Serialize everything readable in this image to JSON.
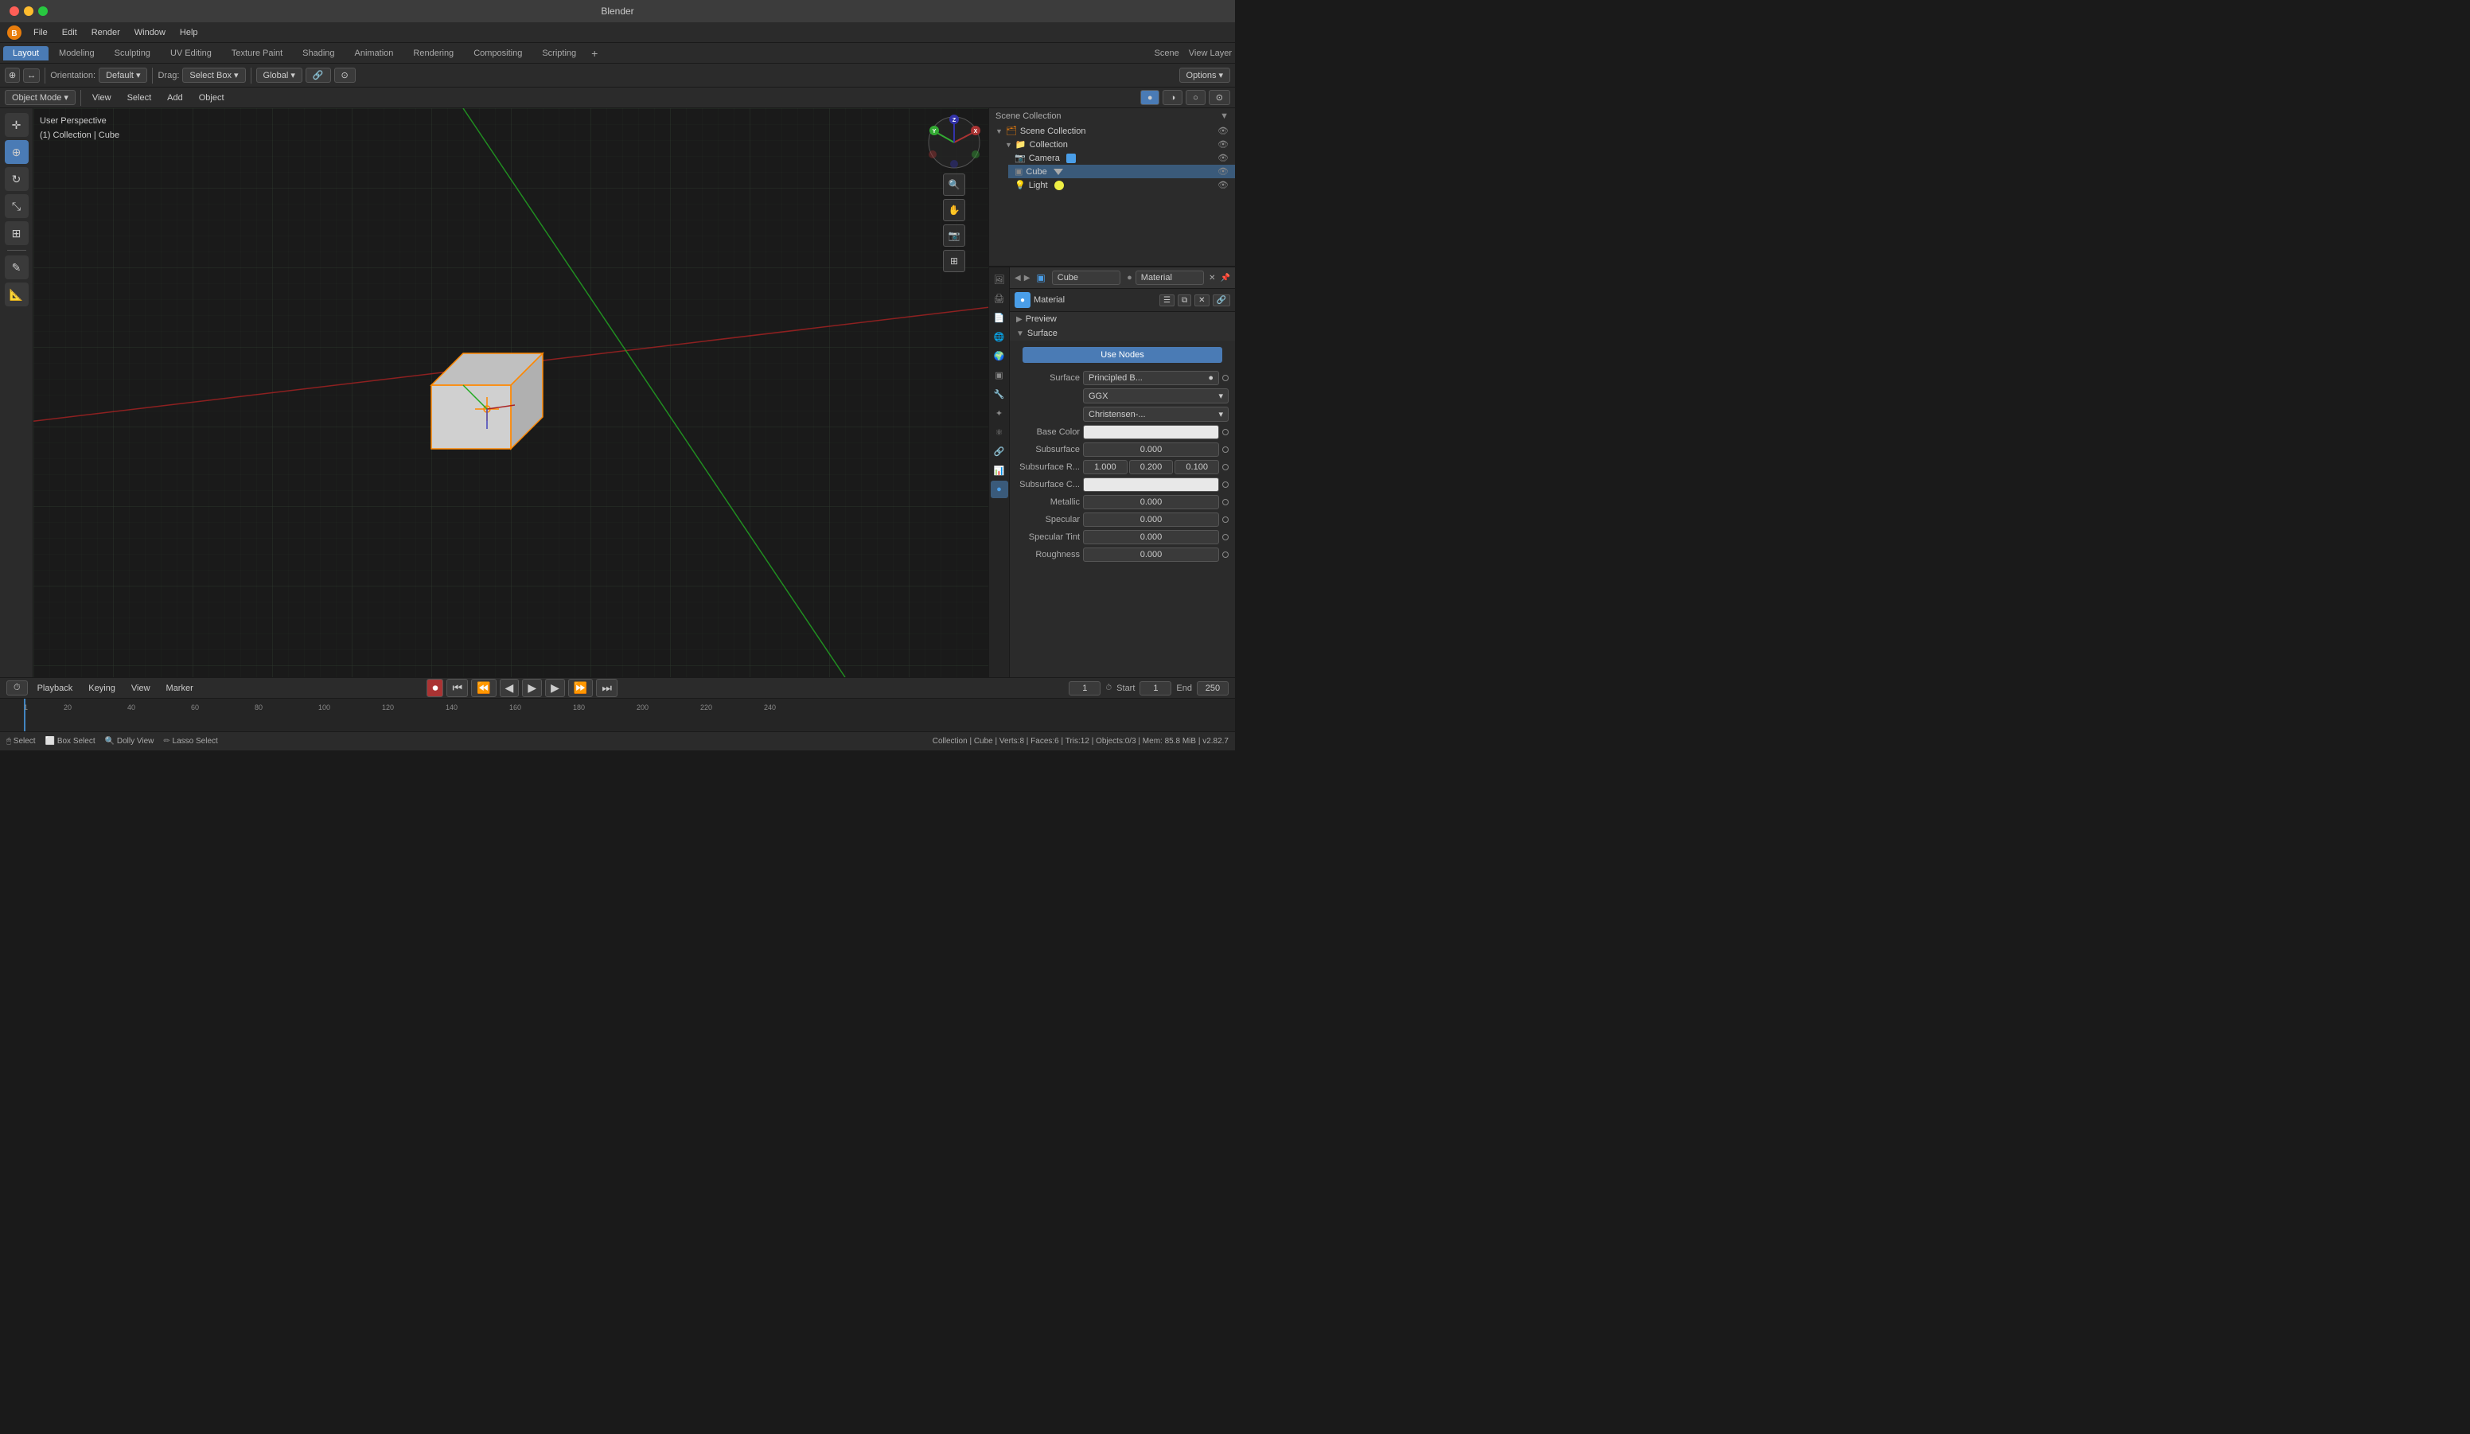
{
  "titleBar": {
    "title": "Blender"
  },
  "menuBar": {
    "items": [
      "File",
      "Edit",
      "Render",
      "Window",
      "Help"
    ]
  },
  "workspaceTabs": {
    "tabs": [
      "Layout",
      "Modeling",
      "Sculpting",
      "UV Editing",
      "Texture Paint",
      "Shading",
      "Animation",
      "Rendering",
      "Compositing",
      "Scripting"
    ],
    "activeTab": "Layout"
  },
  "topToolbar": {
    "orientation_label": "Orientation:",
    "orientation_value": "Default",
    "drag_label": "Drag:",
    "drag_value": "Select Box",
    "pivot_value": "Global",
    "options_label": "Options"
  },
  "secondToolbar": {
    "mode": "Object Mode",
    "view": "View",
    "select": "Select",
    "add": "Add",
    "object": "Object"
  },
  "viewport": {
    "info_line1": "User Perspective",
    "info_line2": "(1) Collection | Cube"
  },
  "leftTools": {
    "tools": [
      "cursor",
      "move",
      "rotate",
      "scale",
      "transform",
      "annotate",
      "measure"
    ]
  },
  "outliner": {
    "title": "Scene Collection",
    "items": [
      {
        "name": "Collection",
        "level": 1,
        "type": "collection",
        "expanded": true
      },
      {
        "name": "Camera",
        "level": 2,
        "type": "camera"
      },
      {
        "name": "Cube",
        "level": 2,
        "type": "mesh",
        "selected": true
      },
      {
        "name": "Light",
        "level": 2,
        "type": "light"
      }
    ]
  },
  "propertiesHeader": {
    "object_name": "Cube",
    "material_name": "Material"
  },
  "materialPanel": {
    "preview_label": "Preview",
    "surface_label": "Surface",
    "use_nodes_btn": "Use Nodes",
    "surface_shader": "Surface",
    "shader_name": "Principled B...",
    "distribution_label": "GGX",
    "sss_label": "Christensen-...",
    "base_color_label": "Base Color",
    "subsurface_label": "Subsurface",
    "subsurface_value": "0.000",
    "subsurface_r_label": "Subsurface R...",
    "subsurface_r_val1": "1.000",
    "subsurface_r_val2": "0.200",
    "subsurface_r_val3": "0.100",
    "subsurface_c_label": "Subsurface C...",
    "metallic_label": "Metallic",
    "metallic_value": "0.000",
    "specular_label": "Specular",
    "specular_value": "0.000",
    "specular_tint_label": "Specular Tint",
    "specular_tint_value": "0.000",
    "roughness_label": "Roughness",
    "roughness_value": "0.000"
  },
  "timeline": {
    "playback_label": "Playback",
    "keying_label": "Keying",
    "view_label": "View",
    "marker_label": "Marker",
    "current_frame": "1",
    "start_label": "Start",
    "start_value": "1",
    "end_label": "End",
    "end_value": "250",
    "frame_markers": [
      "1",
      "20",
      "40",
      "60",
      "80",
      "100",
      "120",
      "140",
      "160",
      "180",
      "200",
      "220",
      "240"
    ]
  },
  "statusBar": {
    "select": "Select",
    "box_select": "Box Select",
    "dolly_view": "Dolly View",
    "lasso_select": "Lasso Select",
    "collection_info": "Collection | Cube | Verts:8 | Faces:6 | Tris:12 | Objects:0/3 | Mem: 85.8 MiB | v2.82.7"
  }
}
